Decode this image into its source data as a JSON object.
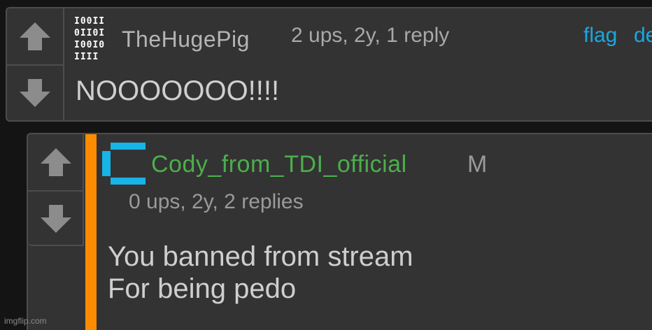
{
  "comments": [
    {
      "username": "TheHugePig",
      "meta": "2 ups, 2y, 1 reply",
      "actions": {
        "flag": "flag",
        "delete": "de"
      },
      "text": "NOOOOOOO!!!!",
      "avatar_rows": [
        "I00II",
        "0II0I",
        "I00I0",
        "IIII"
      ]
    },
    {
      "username": "Cody_from_TDI_official",
      "badge": "M",
      "meta": "0 ups, 2y, 2 replies",
      "text_lines": [
        "You banned from stream",
        "For being pedo"
      ]
    }
  ],
  "icons": {
    "upvote": "arrow-up-icon",
    "downvote": "arrow-down-icon"
  },
  "colors": {
    "background": "#141414",
    "panel": "#333333",
    "border": "#4d4d4d",
    "link": "#1aa7e0",
    "username_green": "#4cae4c",
    "reply_bar": "#ff8c00",
    "avatar_blue": "#16b4e8"
  },
  "watermark": "imgflip.com"
}
